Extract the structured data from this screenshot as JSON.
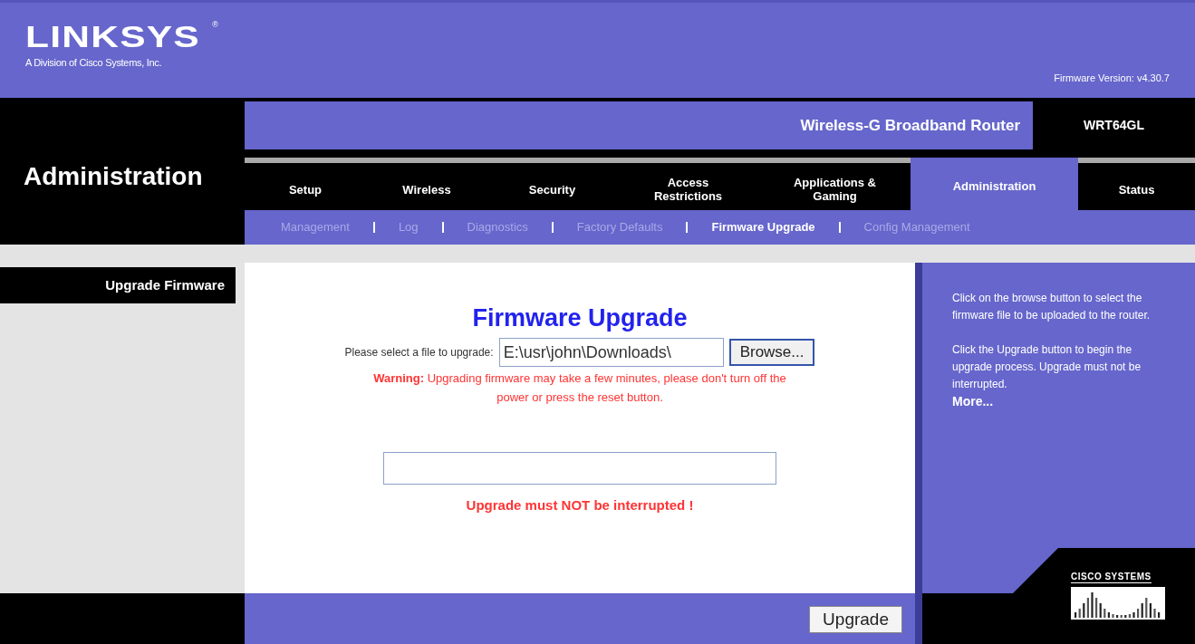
{
  "header": {
    "brand": "LINKSYS",
    "registered": "®",
    "tagline": "A Division of Cisco Systems, Inc.",
    "firmware_version": "Firmware Version: v4.30.7"
  },
  "section_title": "Administration",
  "product": {
    "name": "Wireless-G Broadband Router",
    "model": "WRT64GL"
  },
  "tabs": [
    {
      "label": "Setup",
      "selected": false
    },
    {
      "label": "Wireless",
      "selected": false
    },
    {
      "label": "Security",
      "selected": false
    },
    {
      "label": "Access Restrictions",
      "selected": false
    },
    {
      "label": "Applications & Gaming",
      "selected": false
    },
    {
      "label": "Administration",
      "selected": true
    },
    {
      "label": "Status",
      "selected": false
    }
  ],
  "subtabs": [
    {
      "label": "Management",
      "selected": false
    },
    {
      "label": "Log",
      "selected": false
    },
    {
      "label": "Diagnostics",
      "selected": false
    },
    {
      "label": "Factory Defaults",
      "selected": false
    },
    {
      "label": "Firmware Upgrade",
      "selected": true
    },
    {
      "label": "Config Management",
      "selected": false
    }
  ],
  "sidebar": {
    "heading": "Upgrade Firmware"
  },
  "main": {
    "title": "Firmware Upgrade",
    "file_label": "Please select a file to upgrade:",
    "file_value": "E:\\usr\\john\\Downloads\\",
    "browse_button": "Browse...",
    "warning": "**Warning:** Upgrading firmware may take a few minutes, please don't turn off the power or press the reset button.",
    "notice": "Upgrade must NOT be interrupted !"
  },
  "help": {
    "paragraphs": [
      "Click on the browse button to select the firmware file to be uploaded to the router.",
      "Click the Upgrade button to begin the upgrade process. Upgrade must not be interrupted."
    ],
    "link": "More..."
  },
  "cisco": {
    "wordmark": "CISCO SYSTEMS"
  },
  "footer": {
    "button": "Upgrade"
  }
}
